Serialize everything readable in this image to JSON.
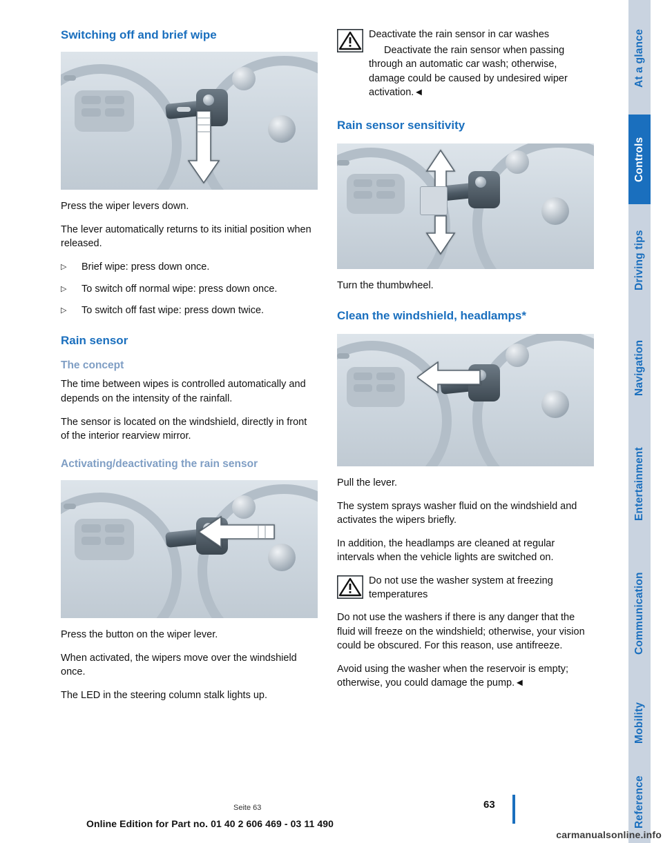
{
  "document": {
    "page_number": "63",
    "footer_text": "Online Edition for Part no. 01 40 2 606 469 - 03 11 490",
    "seat_note": "Seite 63",
    "watermark": "carmanualsonline.info"
  },
  "tabs": [
    {
      "label": "At a glance",
      "color": "#c9d3e0",
      "text_color": "#1a6fbe",
      "active": false
    },
    {
      "label": "Controls",
      "color": "#1a6fbe",
      "text_color": "#ffffff",
      "active": true
    },
    {
      "label": "Driving tips",
      "color": "#c9d3e0",
      "text_color": "#1a6fbe",
      "active": false
    },
    {
      "label": "Navigation",
      "color": "#c9d3e0",
      "text_color": "#1a6fbe",
      "active": false
    },
    {
      "label": "Entertainment",
      "color": "#c9d3e0",
      "text_color": "#1a6fbe",
      "active": false
    },
    {
      "label": "Communication",
      "color": "#c9d3e0",
      "text_color": "#1a6fbe",
      "active": false
    },
    {
      "label": "Mobility",
      "color": "#c9d3e0",
      "text_color": "#1a6fbe",
      "active": false
    },
    {
      "label": "Reference",
      "color": "#c9d3e0",
      "text_color": "#1a6fbe",
      "active": false
    }
  ],
  "left_column": {
    "heading": "Switching off and brief wipe",
    "figure_1_caption": "wiper-stalk-down-arrow",
    "paragraphs": [
      "Press the wiper levers down.",
      "The lever automatically returns to its initial po‑ sition when released."
    ],
    "para_1": "Press the wiper levers down.",
    "para_2": "The lever automatically returns to its initial position when released.",
    "bullets": [
      "Brief wipe: press down once.",
      "To switch off normal wipe: press down once.",
      "To switch off fast wipe: press down twice."
    ],
    "rain_sensor_heading": "Rain sensor",
    "concept_heading": "The concept",
    "concept_para_1": "The time between wipes is controlled automatically and depends on the intensity of the rainfall.",
    "concept_para_2": "The sensor is located on the windshield, directly in front of the interior rearview mirror.",
    "activating_heading": "Activating/deactivating the rain sensor",
    "figure_2_caption": "wiper-stalk-button-arrow",
    "activating_para_1": "Press the button on the wiper lever.",
    "activating_para_2": "When activated, the wipers move over the windshield once.",
    "activating_para_3": "The LED in the steering column stalk lights up."
  },
  "right_column": {
    "warning_1": {
      "icon": "warning-triangle-icon",
      "title": "Deactivate the rain sensor in car washes",
      "body": "Deactivate the rain sensor when passing through an automatic car wash; otherwise, damage could be caused by undesired wiper activation.◄"
    },
    "sensitivity_heading": "Rain sensor sensitivity",
    "figure_3_caption": "thumbwheel-up-down-arrows",
    "sensitivity_para": "Turn the thumbwheel.",
    "clean_heading": "Clean the windshield, headlamps*",
    "figure_4_caption": "wiper-stalk-pull-arrow",
    "clean_para_1": "Pull the lever.",
    "clean_para_2": "The system sprays washer fluid on the windshield and activates the wipers briefly.",
    "clean_para_3": "In addition, the headlamps are cleaned at regular intervals when the vehicle lights are switched on.",
    "warning_2": {
      "icon": "warning-triangle-icon",
      "title": "Do not use the washer system at freezing",
      "title_line2": "temperatures",
      "body_1": "Do not use the washers if there is any danger that the fluid will freeze on the windshield; otherwise, your vision could be obscured. For this reason, use antifreeze.",
      "body_2": "Avoid using the washer when the reservoir is empty; otherwise, you could damage the pump.◄"
    }
  },
  "colors": {
    "heading_blue": "#1a6fbe",
    "subheading_blue": "#7f9ec4",
    "tab_inactive": "#c9d3e0",
    "tab_active": "#1a6fbe",
    "body_text": "#111111"
  }
}
